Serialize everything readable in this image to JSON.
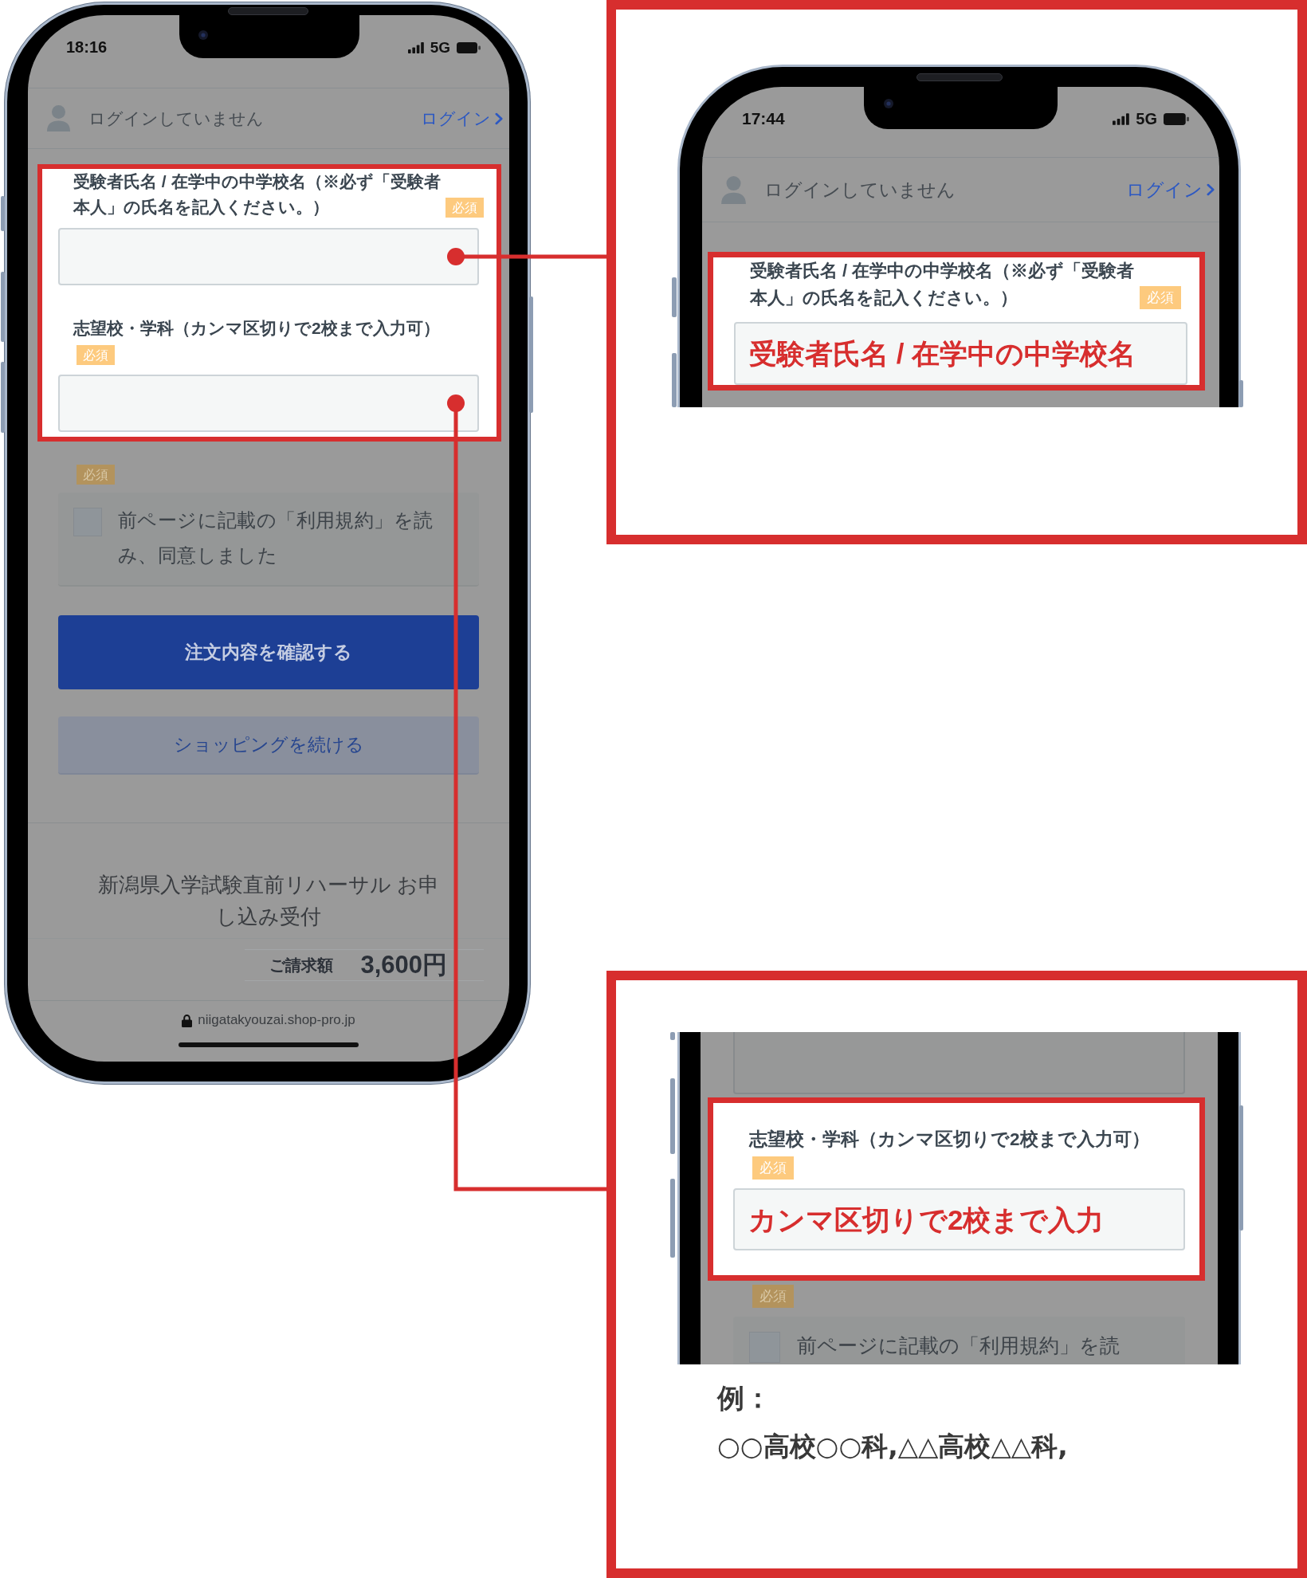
{
  "phone": {
    "status_bar": {
      "time": "18:16",
      "network": "5G"
    },
    "header": {
      "status": "ログインしていません",
      "login_link": "ログイン"
    },
    "fields": [
      {
        "label": "受験者氏名 / 在学中の中学校名（※必ず「受験者本人」の氏名を記入ください。）",
        "badge": "必須",
        "highlighted": true
      },
      {
        "label": "志望校・学科（カンマ区切りで2校まで入力可）",
        "badge": "必須",
        "highlighted": true
      }
    ],
    "agreement": {
      "badge": "必須",
      "label": "前ページに記載の「利用規約」を読み、同意しました",
      "checked": false
    },
    "buttons": [
      {
        "label": "注文内容を確認する",
        "kind": "primary"
      },
      {
        "label": "ショッピングを続ける",
        "kind": "secondary"
      }
    ],
    "cart_title": "新潟県入学試験直前リハーサル お申し込み受付",
    "total": {
      "label": "ご請求額",
      "amount": "3,600円"
    },
    "address_bar": {
      "url": "niigatakyouzai.shop-pro.jp"
    }
  },
  "callouts": [
    {
      "kind": "screen_top",
      "status_bar": {
        "time": "17:44",
        "network": "5G"
      },
      "header": {
        "status": "ログインしていません",
        "login_link": "ログイン"
      },
      "field": {
        "label": "受験者氏名 / 在学中の中学校名（※必ず「受験者本人」の氏名を記入ください。）",
        "badge": "必須",
        "value": "受験者氏名 / 在学中の中学校名",
        "highlighted": true
      }
    },
    {
      "kind": "screen_middle",
      "field": {
        "label": "志望校・学科（カンマ区切りで2校まで入力可）",
        "badge": "必須",
        "value": "カンマ区切りで2校まで入力",
        "highlighted": true
      },
      "agreement": {
        "badge": "必須",
        "label": "前ページに記載の「利用規約」を読",
        "checked": false
      },
      "example": {
        "heading": "例：",
        "text": "○○高校○○科,△△高校△△科,"
      }
    }
  ]
}
